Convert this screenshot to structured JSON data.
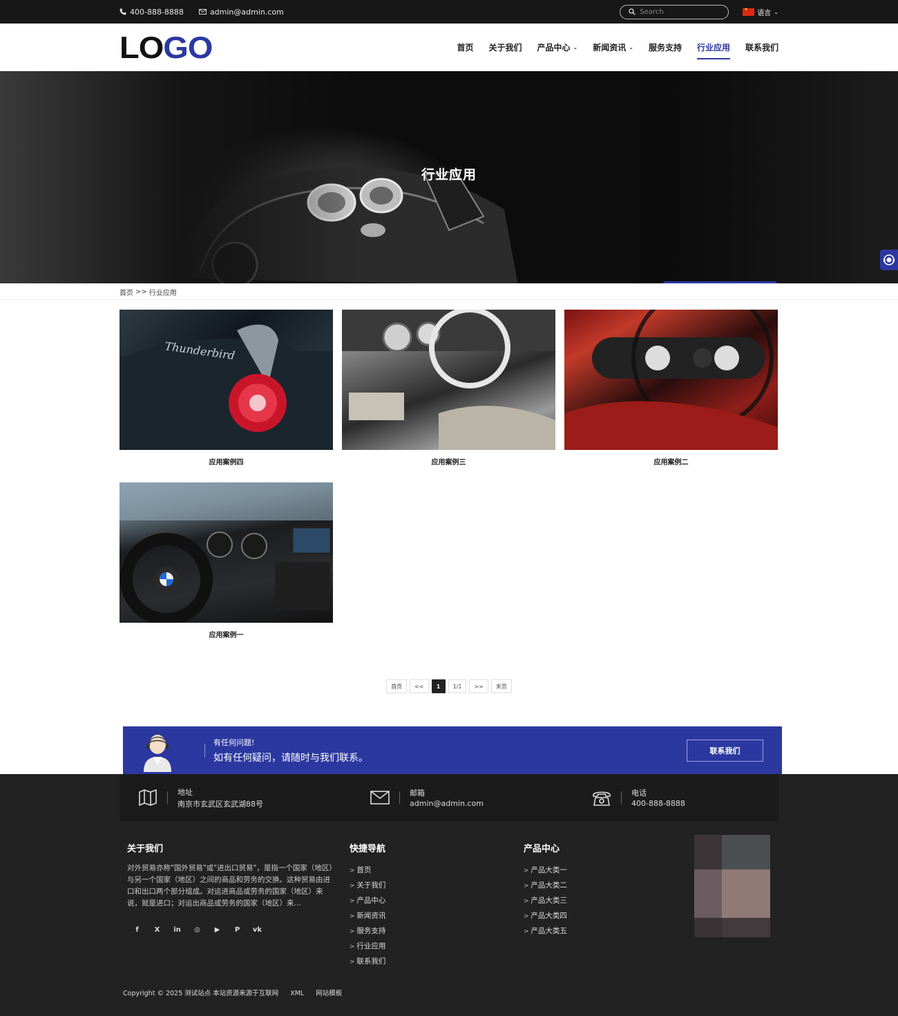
{
  "topbar": {
    "phone": "400-888-8888",
    "email": "admin@admin.com",
    "search_placeholder": "Search",
    "language": "语言"
  },
  "header": {
    "logo_left": "LO",
    "logo_right": "GO",
    "nav": [
      {
        "label": "首页"
      },
      {
        "label": "关于我们"
      },
      {
        "label": "产品中心",
        "has_dropdown": true
      },
      {
        "label": "新闻资讯",
        "has_dropdown": true
      },
      {
        "label": "服务支持"
      },
      {
        "label": "行业应用",
        "active": true
      },
      {
        "label": "联系我们"
      }
    ],
    "accent_color": "#2b38a0"
  },
  "banner": {
    "title": "行业应用"
  },
  "breadcrumb": {
    "home": "首页",
    "sep": ">>",
    "current": "行业应用"
  },
  "cases": [
    {
      "title": "应用案例四"
    },
    {
      "title": "应用案例三"
    },
    {
      "title": "应用案例二"
    },
    {
      "title": "应用案例一"
    }
  ],
  "pagination": {
    "first": "首页",
    "prev": "<<",
    "current": "1",
    "info": "1/1",
    "next": ">>",
    "last": "末页"
  },
  "cta": {
    "question": "有任何问题!",
    "message": "如有任何疑问，请随时与我们联系。",
    "button": "联系我们"
  },
  "footer": {
    "address_label": "地址",
    "address": "南京市玄武区玄武湖88号",
    "email_label": "邮箱",
    "email": "admin@admin.com",
    "phone_label": "电话",
    "phone": "400-888-8888",
    "about_title": "关于我们",
    "about_text": "对外贸易亦称\"国外贸易\"或\"进出口贸易\"，是指一个国家（地区）与另一个国家（地区）之间的商品和劳务的交换。这种贸易由进口和出口两个部分组成。对运进商品或劳务的国家（地区）来说，就是进口；对运出商品或劳务的国家（地区）来...",
    "social": [
      "f",
      "X",
      "in",
      "◎",
      "▶",
      "P",
      "vk"
    ],
    "quick_title": "快捷导航",
    "quick_links": [
      "首页",
      "关于我们",
      "产品中心",
      "新闻资讯",
      "服务支持",
      "行业应用",
      "联系我们"
    ],
    "product_title": "产品中心",
    "product_links": [
      "产品大类一",
      "产品大类二",
      "产品大类三",
      "产品大类四",
      "产品大类五"
    ],
    "copyright": "Copyright © 2025 测试站点 本站资源来源于互联网",
    "xml": "XML",
    "template": "网站模板"
  }
}
